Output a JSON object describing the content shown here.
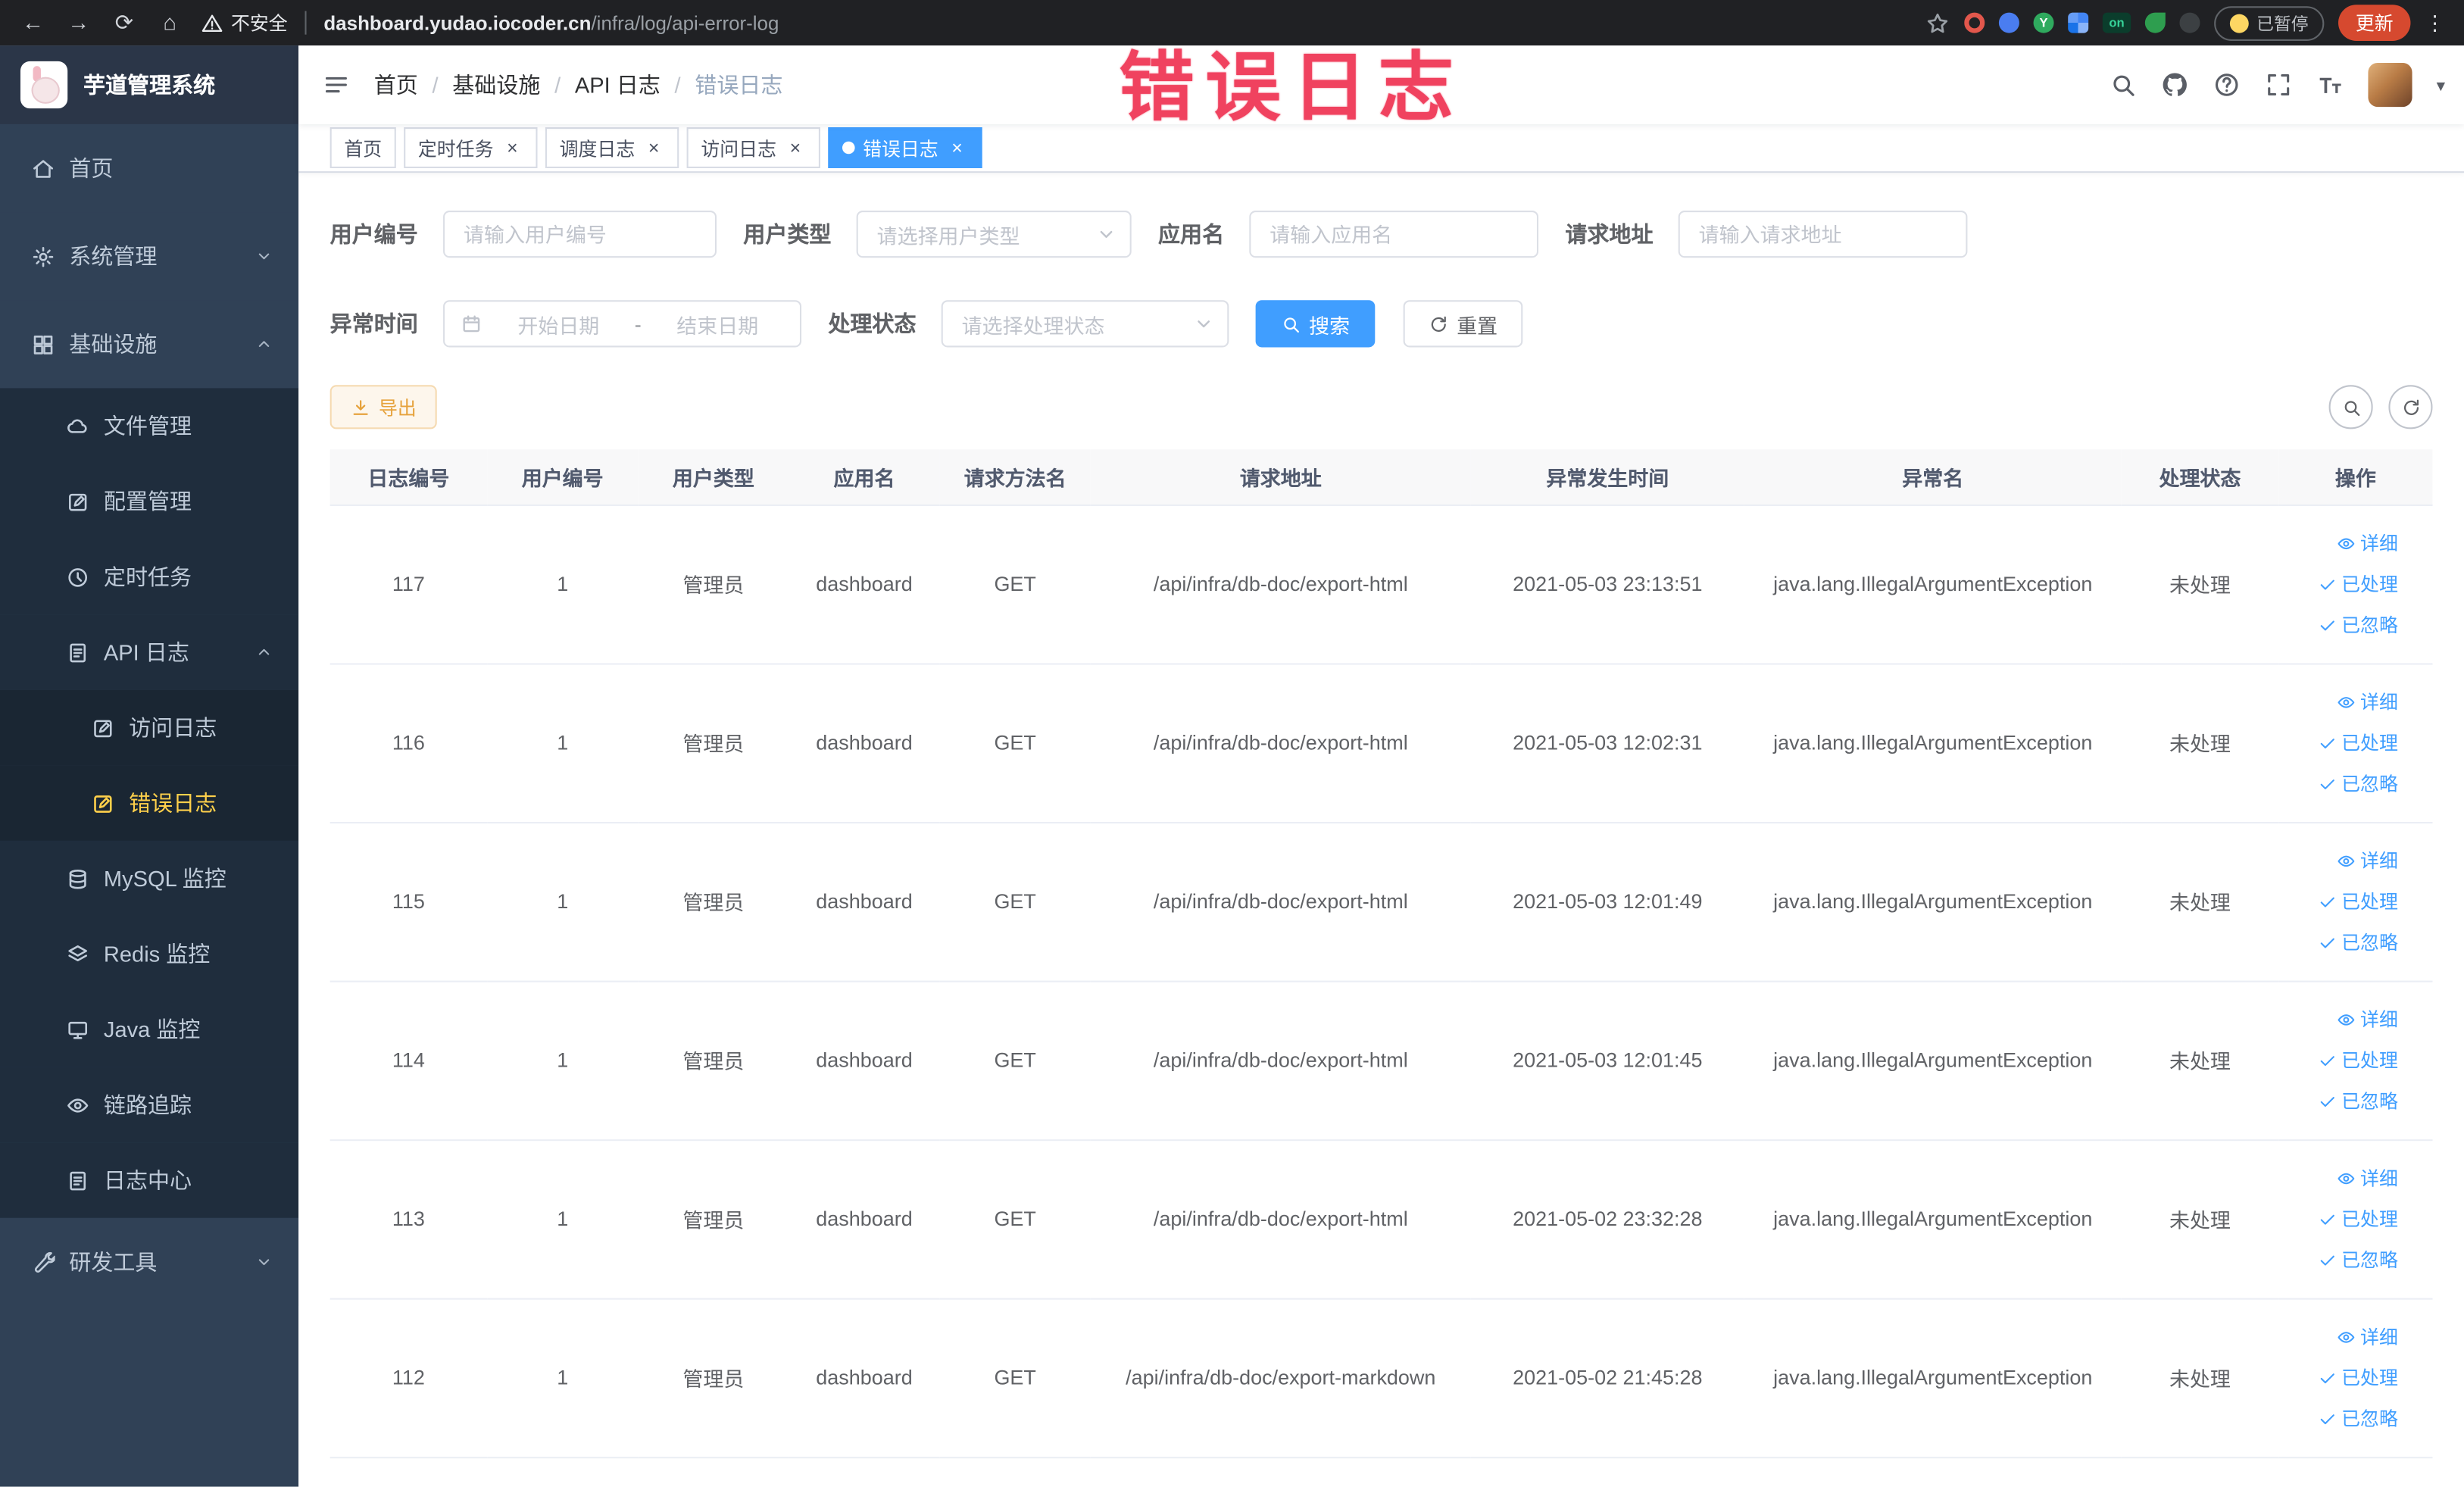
{
  "browser": {
    "security_label": "不安全",
    "url_domain": "dashboard.yudao.iocoder.cn",
    "url_path": "/infra/log/api-error-log",
    "extension_badge": "on",
    "paused_badge": "已暂停",
    "update_button": "更新"
  },
  "annotation": "错误日志",
  "sidebar": {
    "logo_title": "芋道管理系统",
    "items": [
      {
        "label": "首页",
        "icon": "home",
        "level": 1
      },
      {
        "label": "系统管理",
        "icon": "gear",
        "level": 1,
        "arrow": "down"
      },
      {
        "label": "基础设施",
        "icon": "grid",
        "level": 1,
        "arrow": "up"
      },
      {
        "label": "文件管理",
        "icon": "folder",
        "level": 2
      },
      {
        "label": "配置管理",
        "icon": "edit",
        "level": 2
      },
      {
        "label": "定时任务",
        "icon": "clock",
        "level": 2
      },
      {
        "label": "API 日志",
        "icon": "doc",
        "level": 2,
        "arrow": "up"
      },
      {
        "label": "访问日志",
        "icon": "edit",
        "level": 3
      },
      {
        "label": "错误日志",
        "icon": "edit",
        "level": 3,
        "active": true
      },
      {
        "label": "MySQL 监控",
        "icon": "db",
        "level": 2
      },
      {
        "label": "Redis 监控",
        "icon": "layers",
        "level": 2
      },
      {
        "label": "Java 监控",
        "icon": "monitor",
        "level": 2
      },
      {
        "label": "链路追踪",
        "icon": "eye",
        "level": 2
      },
      {
        "label": "日志中心",
        "icon": "doc",
        "level": 2
      },
      {
        "label": "研发工具",
        "icon": "wrench",
        "level": 1,
        "arrow": "down"
      }
    ]
  },
  "navbar": {
    "breadcrumb": [
      "首页",
      "基础设施",
      "API 日志",
      "错误日志"
    ]
  },
  "tabs": [
    {
      "label": "首页",
      "closable": false,
      "active": false
    },
    {
      "label": "定时任务",
      "closable": true,
      "active": false
    },
    {
      "label": "调度日志",
      "closable": true,
      "active": false
    },
    {
      "label": "访问日志",
      "closable": true,
      "active": false
    },
    {
      "label": "错误日志",
      "closable": true,
      "active": true
    }
  ],
  "filters": {
    "user_id": {
      "label": "用户编号",
      "placeholder": "请输入用户编号"
    },
    "user_type": {
      "label": "用户类型",
      "placeholder": "请选择用户类型"
    },
    "app_name": {
      "label": "应用名",
      "placeholder": "请输入应用名"
    },
    "request_url": {
      "label": "请求地址",
      "placeholder": "请输入请求地址"
    },
    "exception_time": {
      "label": "异常时间",
      "start_placeholder": "开始日期",
      "separator": "-",
      "end_placeholder": "结束日期"
    },
    "process_status": {
      "label": "处理状态",
      "placeholder": "请选择处理状态"
    },
    "search_button": "搜索",
    "reset_button": "重置"
  },
  "toolbar": {
    "export_label": "导出"
  },
  "table": {
    "columns": [
      "日志编号",
      "用户编号",
      "用户类型",
      "应用名",
      "请求方法名",
      "请求地址",
      "异常发生时间",
      "异常名",
      "处理状态",
      "操作"
    ],
    "actions": {
      "detail": "详细",
      "processed": "已处理",
      "ignored": "已忽略"
    },
    "rows": [
      {
        "id": "117",
        "user_id": "1",
        "user_type": "管理员",
        "app_name": "dashboard",
        "method": "GET",
        "url": "/api/infra/db-doc/export-html",
        "time": "2021-05-03 23:13:51",
        "exception": "java.lang.IllegalArgumentException",
        "status": "未处理"
      },
      {
        "id": "116",
        "user_id": "1",
        "user_type": "管理员",
        "app_name": "dashboard",
        "method": "GET",
        "url": "/api/infra/db-doc/export-html",
        "time": "2021-05-03 12:02:31",
        "exception": "java.lang.IllegalArgumentException",
        "status": "未处理"
      },
      {
        "id": "115",
        "user_id": "1",
        "user_type": "管理员",
        "app_name": "dashboard",
        "method": "GET",
        "url": "/api/infra/db-doc/export-html",
        "time": "2021-05-03 12:01:49",
        "exception": "java.lang.IllegalArgumentException",
        "status": "未处理"
      },
      {
        "id": "114",
        "user_id": "1",
        "user_type": "管理员",
        "app_name": "dashboard",
        "method": "GET",
        "url": "/api/infra/db-doc/export-html",
        "time": "2021-05-03 12:01:45",
        "exception": "java.lang.IllegalArgumentException",
        "status": "未处理"
      },
      {
        "id": "113",
        "user_id": "1",
        "user_type": "管理员",
        "app_name": "dashboard",
        "method": "GET",
        "url": "/api/infra/db-doc/export-html",
        "time": "2021-05-02 23:32:28",
        "exception": "java.lang.IllegalArgumentException",
        "status": "未处理"
      },
      {
        "id": "112",
        "user_id": "1",
        "user_type": "管理员",
        "app_name": "dashboard",
        "method": "GET",
        "url": "/api/infra/db-doc/export-markdown",
        "time": "2021-05-02 21:45:28",
        "exception": "java.lang.IllegalArgumentException",
        "status": "未处理"
      }
    ]
  }
}
